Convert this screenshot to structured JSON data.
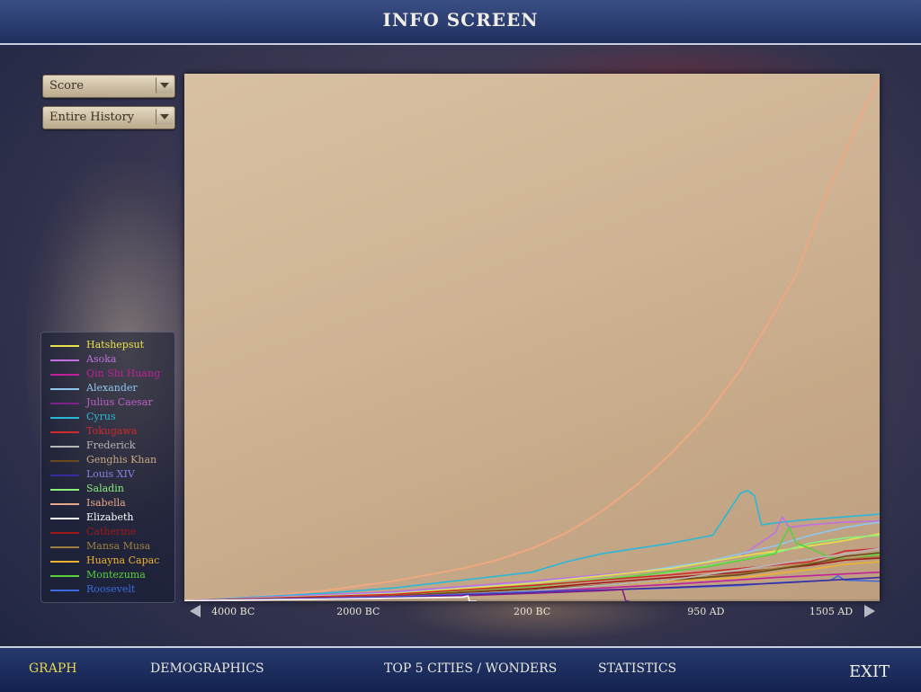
{
  "header": {
    "title": "INFO SCREEN"
  },
  "controls": {
    "metric_dropdown": {
      "value": "Score"
    },
    "range_dropdown": {
      "value": "Entire History"
    }
  },
  "legend": [
    {
      "name": "Hatshepsut",
      "color": "#e8e24a"
    },
    {
      "name": "Asoka",
      "color": "#c070e0"
    },
    {
      "name": "Qin Shi Huang",
      "color": "#c0209a"
    },
    {
      "name": "Alexander",
      "color": "#8ec8f0"
    },
    {
      "name": "Julius Caesar",
      "color": "#80208a"
    },
    {
      "name": "Cyrus",
      "color": "#2ab8d8"
    },
    {
      "name": "Tokugawa",
      "color": "#d02a2a"
    },
    {
      "name": "Frederick",
      "color": "#b8b8b8"
    },
    {
      "name": "Genghis Khan",
      "color": "#6a4a1a"
    },
    {
      "name": "Louis XIV",
      "color": "#3a2aa0"
    },
    {
      "name": "Saladin",
      "color": "#8af07a"
    },
    {
      "name": "Isabella",
      "color": "#e8a888"
    },
    {
      "name": "Elizabeth",
      "color": "#ffffff"
    },
    {
      "name": "Catherine",
      "color": "#a01818"
    },
    {
      "name": "Mansa Musa",
      "color": "#a08040"
    },
    {
      "name": "Huayna Capac",
      "color": "#f0b030"
    },
    {
      "name": "Montezuma",
      "color": "#5ad03a"
    },
    {
      "name": "Roosevelt",
      "color": "#3a6ae0"
    }
  ],
  "chart_data": {
    "type": "line",
    "x_tick_labels": [
      "4000 BC",
      "2000 BC",
      "200 BC",
      "950 AD",
      "1505 AD"
    ],
    "x_tick_pos": [
      0.07,
      0.25,
      0.5,
      0.75,
      0.93
    ],
    "x_range": [
      0,
      1
    ],
    "y_range": [
      0,
      1000
    ],
    "series": [
      {
        "name": "Isabella",
        "color": "#f0a880",
        "points": [
          [
            0,
            2
          ],
          [
            0.1,
            8
          ],
          [
            0.2,
            20
          ],
          [
            0.3,
            38
          ],
          [
            0.4,
            62
          ],
          [
            0.45,
            78
          ],
          [
            0.5,
            100
          ],
          [
            0.55,
            130
          ],
          [
            0.6,
            170
          ],
          [
            0.65,
            220
          ],
          [
            0.7,
            280
          ],
          [
            0.75,
            350
          ],
          [
            0.8,
            440
          ],
          [
            0.85,
            550
          ],
          [
            0.88,
            620
          ],
          [
            0.9,
            690
          ],
          [
            0.92,
            760
          ],
          [
            0.94,
            820
          ],
          [
            0.96,
            880
          ],
          [
            0.98,
            940
          ],
          [
            1,
            990
          ]
        ]
      },
      {
        "name": "Cyrus",
        "color": "#2ab8d8",
        "points": [
          [
            0,
            1
          ],
          [
            0.2,
            15
          ],
          [
            0.3,
            25
          ],
          [
            0.4,
            40
          ],
          [
            0.5,
            55
          ],
          [
            0.55,
            75
          ],
          [
            0.6,
            90
          ],
          [
            0.65,
            100
          ],
          [
            0.7,
            110
          ],
          [
            0.76,
            125
          ],
          [
            0.8,
            205
          ],
          [
            0.81,
            210
          ],
          [
            0.82,
            200
          ],
          [
            0.83,
            145
          ],
          [
            0.86,
            150
          ],
          [
            0.9,
            155
          ],
          [
            0.95,
            160
          ],
          [
            1,
            165
          ]
        ]
      },
      {
        "name": "Asoka",
        "color": "#c070e0",
        "points": [
          [
            0,
            1
          ],
          [
            0.3,
            18
          ],
          [
            0.5,
            38
          ],
          [
            0.6,
            50
          ],
          [
            0.7,
            62
          ],
          [
            0.8,
            85
          ],
          [
            0.85,
            130
          ],
          [
            0.86,
            160
          ],
          [
            0.87,
            140
          ],
          [
            0.9,
            145
          ],
          [
            0.95,
            150
          ],
          [
            1,
            152
          ]
        ]
      },
      {
        "name": "Alexander",
        "color": "#8ec8f0",
        "points": [
          [
            0,
            1
          ],
          [
            0.3,
            15
          ],
          [
            0.5,
            35
          ],
          [
            0.65,
            55
          ],
          [
            0.75,
            75
          ],
          [
            0.85,
            105
          ],
          [
            0.9,
            125
          ],
          [
            0.95,
            140
          ],
          [
            1,
            150
          ]
        ]
      },
      {
        "name": "Hatshepsut",
        "color": "#e8e24a",
        "points": [
          [
            0,
            1
          ],
          [
            0.3,
            14
          ],
          [
            0.5,
            34
          ],
          [
            0.6,
            48
          ],
          [
            0.7,
            62
          ],
          [
            0.8,
            85
          ],
          [
            0.9,
            105
          ],
          [
            0.95,
            115
          ],
          [
            1,
            128
          ]
        ]
      },
      {
        "name": "Saladin",
        "color": "#8af07a",
        "points": [
          [
            0,
            1
          ],
          [
            0.3,
            12
          ],
          [
            0.5,
            30
          ],
          [
            0.6,
            42
          ],
          [
            0.7,
            55
          ],
          [
            0.8,
            78
          ],
          [
            0.86,
            95
          ],
          [
            0.9,
            110
          ],
          [
            0.95,
            120
          ],
          [
            1,
            125
          ]
        ]
      },
      {
        "name": "Montezuma",
        "color": "#5ad03a",
        "points": [
          [
            0,
            1
          ],
          [
            0.3,
            12
          ],
          [
            0.5,
            28
          ],
          [
            0.65,
            48
          ],
          [
            0.75,
            65
          ],
          [
            0.85,
            90
          ],
          [
            0.87,
            140
          ],
          [
            0.88,
            110
          ],
          [
            0.9,
            100
          ],
          [
            0.93,
            82
          ],
          [
            0.96,
            80
          ],
          [
            1,
            90
          ]
        ]
      },
      {
        "name": "Tokugawa",
        "color": "#d02a2a",
        "points": [
          [
            0,
            1
          ],
          [
            0.3,
            13
          ],
          [
            0.5,
            30
          ],
          [
            0.6,
            40
          ],
          [
            0.7,
            50
          ],
          [
            0.8,
            62
          ],
          [
            0.9,
            75
          ],
          [
            0.95,
            95
          ],
          [
            1,
            100
          ]
        ]
      },
      {
        "name": "Catherine",
        "color": "#a01818",
        "points": [
          [
            0,
            1
          ],
          [
            0.3,
            10
          ],
          [
            0.5,
            24
          ],
          [
            0.6,
            35
          ],
          [
            0.7,
            45
          ],
          [
            0.8,
            55
          ],
          [
            0.9,
            68
          ],
          [
            0.95,
            78
          ],
          [
            1,
            82
          ]
        ]
      },
      {
        "name": "Huayna Capac",
        "color": "#f0b030",
        "points": [
          [
            0,
            1
          ],
          [
            0.3,
            10
          ],
          [
            0.5,
            22
          ],
          [
            0.6,
            30
          ],
          [
            0.7,
            38
          ],
          [
            0.8,
            45
          ],
          [
            0.9,
            60
          ],
          [
            0.95,
            70
          ],
          [
            1,
            75
          ]
        ]
      },
      {
        "name": "Mansa Musa",
        "color": "#a08040",
        "points": [
          [
            0,
            1
          ],
          [
            0.3,
            9
          ],
          [
            0.5,
            20
          ],
          [
            0.6,
            30
          ],
          [
            0.7,
            40
          ],
          [
            0.8,
            52
          ],
          [
            0.9,
            72
          ],
          [
            0.95,
            80
          ],
          [
            1,
            85
          ]
        ]
      },
      {
        "name": "Genghis Khan",
        "color": "#6a4a1a",
        "points": [
          [
            0,
            1
          ],
          [
            0.3,
            10
          ],
          [
            0.5,
            22
          ],
          [
            0.65,
            35
          ],
          [
            0.8,
            50
          ],
          [
            0.9,
            70
          ],
          [
            0.95,
            85
          ],
          [
            1,
            92
          ]
        ]
      },
      {
        "name": "Frederick",
        "color": "#b8b8b8",
        "points": [
          [
            0,
            1
          ],
          [
            0.3,
            8
          ],
          [
            0.5,
            20
          ],
          [
            0.7,
            40
          ],
          [
            0.8,
            60
          ],
          [
            0.9,
            80
          ],
          [
            1,
            100
          ]
        ]
      },
      {
        "name": "Qin Shi Huang",
        "color": "#c0209a",
        "points": [
          [
            0,
            1
          ],
          [
            0.3,
            9
          ],
          [
            0.5,
            18
          ],
          [
            0.7,
            32
          ],
          [
            0.85,
            45
          ],
          [
            1,
            55
          ]
        ]
      },
      {
        "name": "Roosevelt",
        "color": "#3a6ae0",
        "points": [
          [
            0,
            1
          ],
          [
            0.3,
            8
          ],
          [
            0.5,
            18
          ],
          [
            0.7,
            25
          ],
          [
            0.8,
            30
          ],
          [
            0.85,
            35
          ],
          [
            0.9,
            38
          ],
          [
            0.93,
            40
          ],
          [
            0.94,
            48
          ],
          [
            0.95,
            40
          ],
          [
            1,
            38
          ]
        ]
      },
      {
        "name": "Louis XIV",
        "color": "#3a2aa0",
        "points": [
          [
            0,
            1
          ],
          [
            0.3,
            7
          ],
          [
            0.5,
            16
          ],
          [
            0.7,
            26
          ],
          [
            0.85,
            34
          ],
          [
            1,
            45
          ]
        ]
      },
      {
        "name": "Julius Caesar",
        "color": "#80208a",
        "points": [
          [
            0,
            1
          ],
          [
            0.3,
            6
          ],
          [
            0.5,
            15
          ],
          [
            0.6,
            20
          ],
          [
            0.63,
            22
          ],
          [
            0.635,
            0
          ],
          [
            0.64,
            0
          ]
        ]
      },
      {
        "name": "Elizabeth",
        "color": "#ffffff",
        "points": [
          [
            0,
            1
          ],
          [
            0.2,
            4
          ],
          [
            0.4,
            8
          ],
          [
            0.408,
            10
          ],
          [
            0.41,
            0
          ],
          [
            0.42,
            0
          ]
        ]
      }
    ]
  },
  "footer": {
    "tabs": [
      {
        "label": "GRAPH",
        "active": true
      },
      {
        "label": "DEMOGRAPHICS",
        "active": false
      },
      {
        "label": "TOP 5 CITIES / WONDERS",
        "active": false
      },
      {
        "label": "STATISTICS",
        "active": false
      }
    ],
    "exit_label": "EXIT"
  }
}
